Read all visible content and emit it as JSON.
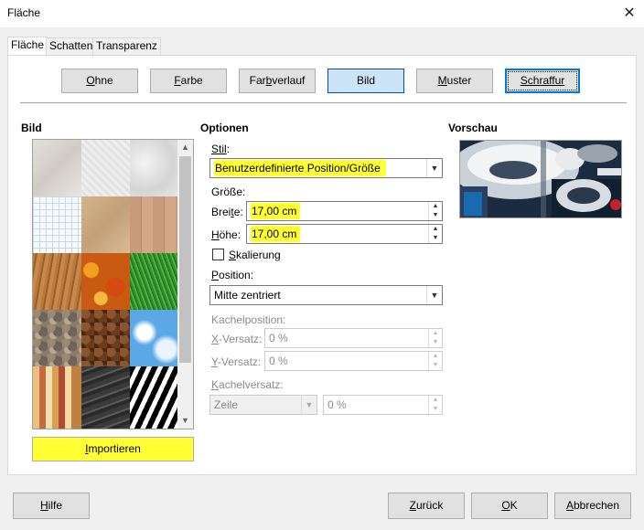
{
  "window": {
    "title": "Fläche",
    "close_glyph": "✕"
  },
  "tabs": [
    {
      "label": "Fläche",
      "active": true
    },
    {
      "label": "Schatten",
      "active": false
    },
    {
      "label": "Transparenz",
      "active": false
    }
  ],
  "fill_types": [
    {
      "label": "Ohne",
      "mn": "O",
      "rest": "hne"
    },
    {
      "label": "Farbe",
      "mn": "F",
      "rest": "arbe"
    },
    {
      "label": "Farbverlauf",
      "pre": "Far",
      "mn": "b",
      "rest": "verlauf"
    },
    {
      "label": "Bild",
      "state": "selected"
    },
    {
      "label": "Muster",
      "mn": "M",
      "rest": "uster"
    },
    {
      "label": "Schraffur",
      "state": "focused"
    }
  ],
  "bild_section": {
    "heading": "Bild",
    "import_button": {
      "mn": "I",
      "rest": "mportieren",
      "highlighted": true
    }
  },
  "optionen": {
    "heading": "Optionen",
    "stil_label": {
      "mn": "Stil",
      "rest": ":"
    },
    "stil_value": "Benutzerdefinierte Position/Größe",
    "groesse_label": "Größe:",
    "breite_label": {
      "pre": "Brei",
      "mn": "t",
      "rest": "e:"
    },
    "breite_value": "17,00 cm",
    "hoehe_label": {
      "mn": "H",
      "rest": "öhe:"
    },
    "hoehe_value": "17,00 cm",
    "skalierung": {
      "mn": "S",
      "rest": "kalierung",
      "checked": false
    },
    "position_label": {
      "mn": "P",
      "rest": "osition:"
    },
    "position_value": "Mitte zentriert",
    "kachelposition_label": "Kachelposition:",
    "x_versatz_label": {
      "mn": "X",
      "rest": "-Versatz:"
    },
    "x_versatz_value": "0 %",
    "y_versatz_label": {
      "mn": "Y",
      "rest": "-Versatz:"
    },
    "y_versatz_value": "0 %",
    "kachelversatz_label": {
      "mn": "K",
      "rest": "achelversatz:"
    },
    "kachelversatz_mode": "Zeile",
    "kachelversatz_value": "0 %"
  },
  "vorschau": {
    "heading": "Vorschau"
  },
  "footer": {
    "hilfe": {
      "mn": "H",
      "rest": "ilfe"
    },
    "zurueck": {
      "mn": "Z",
      "rest": "urück"
    },
    "ok": {
      "mn": "O",
      "rest": "K"
    },
    "abbrechen": {
      "mn": "A",
      "rest": "bbrechen"
    }
  },
  "colors": {
    "highlight": "#ffff33",
    "selected_button": "#cce4f7",
    "focus_border": "#0078d7"
  }
}
